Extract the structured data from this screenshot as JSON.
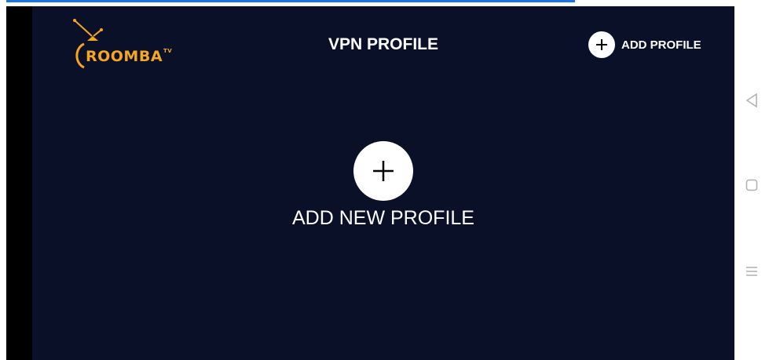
{
  "app": {
    "logo_text": "ROOMBA",
    "logo_superscript": "TV",
    "title": "VPN PROFILE",
    "add_profile_label": "ADD PROFILE",
    "add_new_profile_label": "ADD NEW PROFILE"
  },
  "icons": {
    "add_profile": "plus-icon",
    "add_new_profile": "plus-icon",
    "nav_back": "triangle-back-icon",
    "nav_home": "square-home-icon",
    "nav_menu": "menu-lines-icon"
  },
  "colors": {
    "background": "#0b1029",
    "logo": "#f5a623",
    "text": "#ffffff",
    "accent_bar": "#1a73e8"
  }
}
